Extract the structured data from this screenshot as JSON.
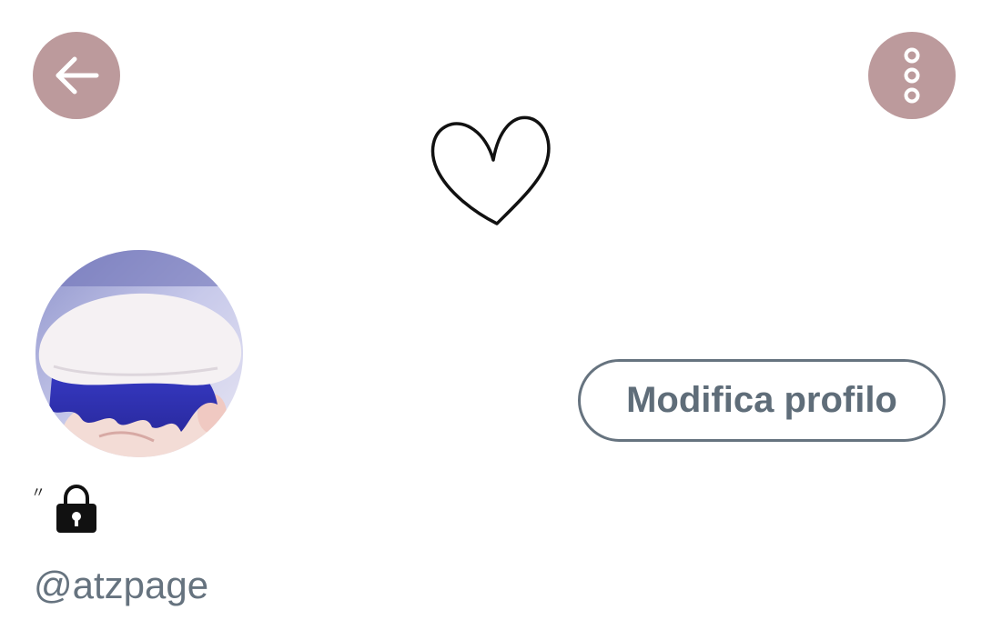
{
  "header": {
    "back_icon": "arrow-left-icon",
    "more_icon": "more-vertical-icon",
    "button_color": "#bc9a9c",
    "banner_icon": "heart-outline-icon"
  },
  "profile": {
    "avatar_icon": "avatar-photo",
    "display_name": "〃",
    "lock_icon": "lock-icon",
    "handle": "@atzpage"
  },
  "actions": {
    "edit_profile_label": "Modifica profilo"
  },
  "colors": {
    "accent_text": "#66737f",
    "background": "#ffffff"
  }
}
